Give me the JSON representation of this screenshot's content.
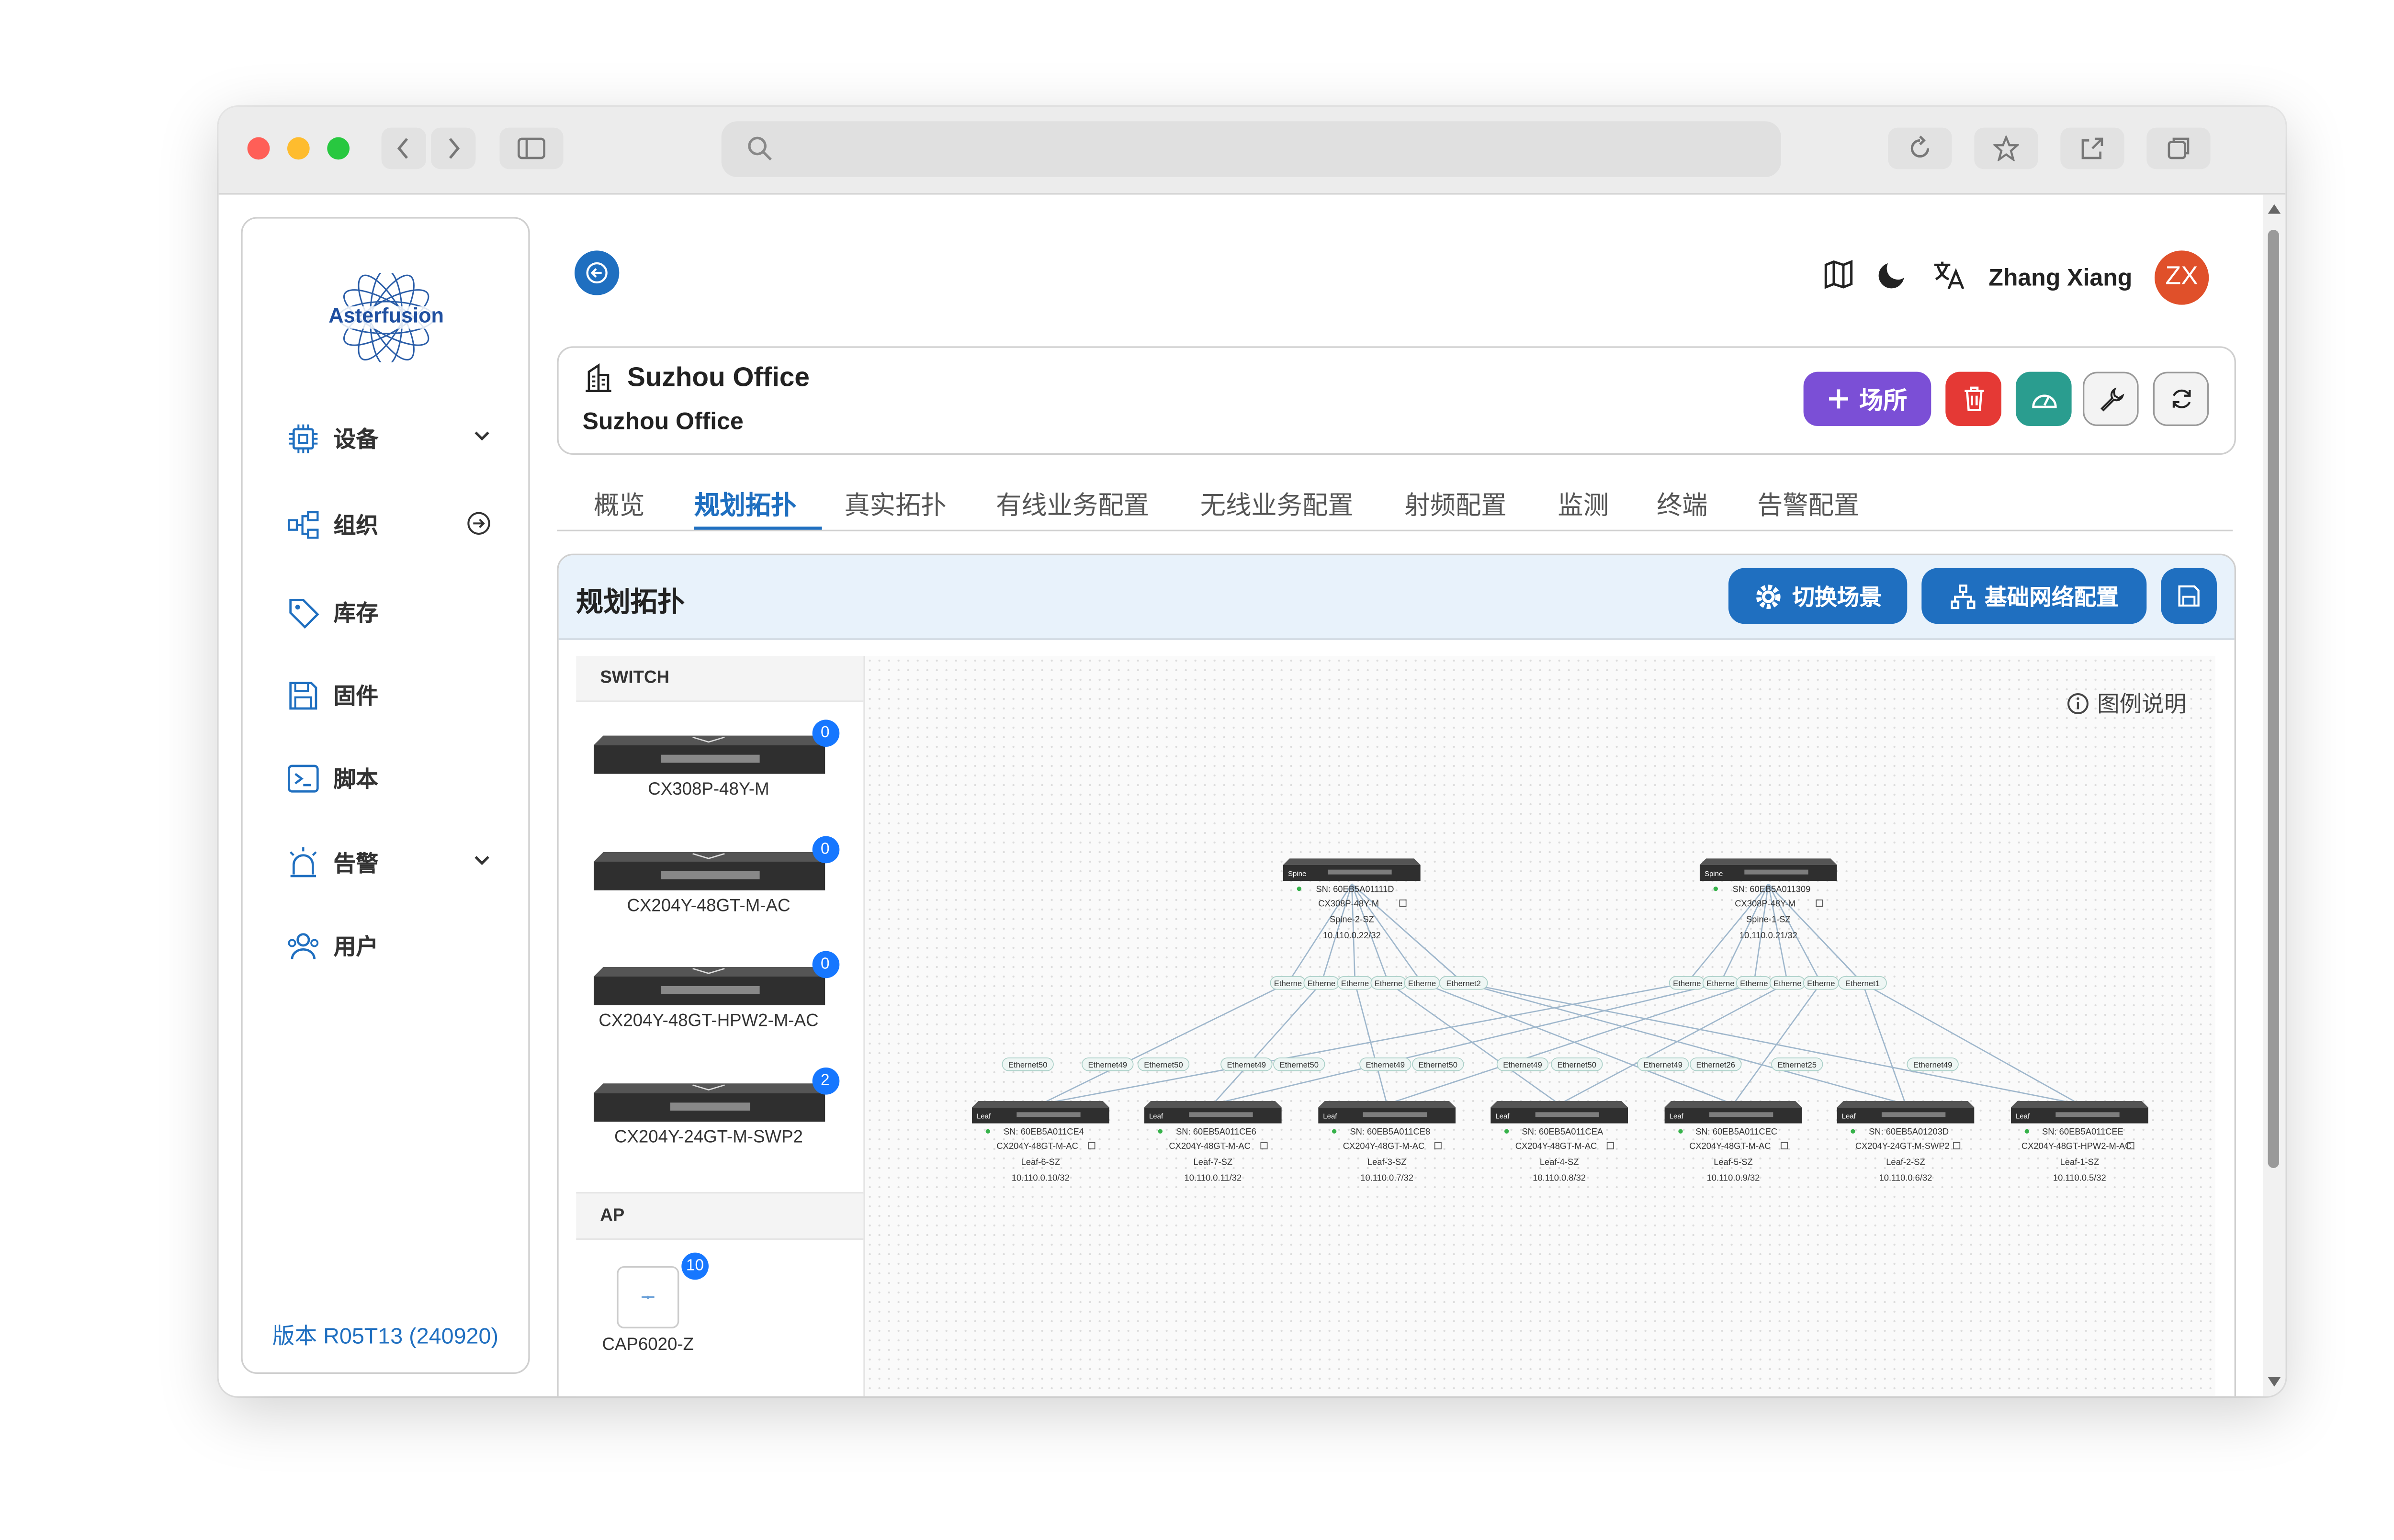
{
  "browser": {
    "back_icon": "chevron-left-icon",
    "forward_icon": "chevron-right-icon",
    "sidebar_toggle_icon": "sidebar-icon",
    "search_icon": "search-icon",
    "reload_icon": "reload-icon",
    "bookmark_icon": "star-icon",
    "share_icon": "share-icon",
    "tabs_icon": "tabs-icon",
    "url": ""
  },
  "sidebar": {
    "logo_text": "Asterfusion",
    "items": [
      {
        "label": "设备",
        "icon": "chip-icon",
        "tail": "chevron-down-icon"
      },
      {
        "label": "组织",
        "icon": "org-icon",
        "tail": "arrow-circle-icon"
      },
      {
        "label": "库存",
        "icon": "tag-icon",
        "tail": ""
      },
      {
        "label": "固件",
        "icon": "save-icon",
        "tail": ""
      },
      {
        "label": "脚本",
        "icon": "terminal-icon",
        "tail": ""
      },
      {
        "label": "告警",
        "icon": "alarm-icon",
        "tail": "chevron-down-icon"
      },
      {
        "label": "用户",
        "icon": "users-icon",
        "tail": ""
      }
    ],
    "version": "版本 R05T13 (240920)"
  },
  "topbar": {
    "user_name": "Zhang Xiang",
    "avatar_initials": "ZX",
    "avatar_color": "#e0502a"
  },
  "site": {
    "title": "Suzhou Office",
    "subtitle": "Suzhou Office",
    "add_button": "场所",
    "accent_purple": "#7b4fd6",
    "accent_red": "#e53935",
    "accent_teal": "#2a9d8f"
  },
  "tabs": [
    "概览",
    "规划拓扑",
    "真实拓扑",
    "有线业务配置",
    "无线业务配置",
    "射频配置",
    "监测",
    "终端",
    "告警配置"
  ],
  "active_tab": "规划拓扑",
  "topology": {
    "title": "规划拓扑",
    "switch_scene": "切换场景",
    "base_network": "基础网络配置",
    "legend": "图例说明",
    "palette": {
      "switch_header": "SWITCH",
      "switches": [
        {
          "model": "CX308P-48Y-M",
          "count": "0"
        },
        {
          "model": "CX204Y-48GT-M-AC",
          "count": "0"
        },
        {
          "model": "CX204Y-48GT-HPW2-M-AC",
          "count": "0"
        },
        {
          "model": "CX204Y-24GT-M-SWP2",
          "count": "2"
        }
      ],
      "ap_header": "AP",
      "aps": [
        {
          "model": "CAP6020-Z",
          "count": "10"
        }
      ]
    },
    "spines": [
      {
        "tag": "Spine",
        "sn": "SN: 60EB5A01111D",
        "model": "CX308P-48Y-M",
        "name": "Spine-2-SZ",
        "ip": "10.110.0.22/32"
      },
      {
        "tag": "Spine",
        "sn": "SN: 60EB5A011309",
        "model": "CX308P-48Y-M",
        "name": "Spine-1-SZ",
        "ip": "10.110.0.21/32"
      }
    ],
    "leaves": [
      {
        "tag": "Leaf",
        "sn": "SN: 60EB5A011CE4",
        "model": "CX204Y-48GT-M-AC",
        "name": "Leaf-6-SZ",
        "ip": "10.110.0.10/32"
      },
      {
        "tag": "Leaf",
        "sn": "SN: 60EB5A011CE6",
        "model": "CX204Y-48GT-M-AC",
        "name": "Leaf-7-SZ",
        "ip": "10.110.0.11/32"
      },
      {
        "tag": "Leaf",
        "sn": "SN: 60EB5A011CE8",
        "model": "CX204Y-48GT-M-AC",
        "name": "Leaf-3-SZ",
        "ip": "10.110.0.7/32"
      },
      {
        "tag": "Leaf",
        "sn": "SN: 60EB5A011CEA",
        "model": "CX204Y-48GT-M-AC",
        "name": "Leaf-4-SZ",
        "ip": "10.110.0.8/32"
      },
      {
        "tag": "Leaf",
        "sn": "SN: 60EB5A011CEC",
        "model": "CX204Y-48GT-M-AC",
        "name": "Leaf-5-SZ",
        "ip": "10.110.0.9/32"
      },
      {
        "tag": "Leaf",
        "sn": "SN: 60EB5A01203D",
        "model": "CX204Y-24GT-M-SWP2",
        "name": "Leaf-2-SZ",
        "ip": "10.110.0.6/32"
      },
      {
        "tag": "Leaf",
        "sn": "SN: 60EB5A011CEE",
        "model": "CX204Y-48GT-HPW2-M-AC",
        "name": "Leaf-1-SZ",
        "ip": "10.110.0.5/32"
      }
    ],
    "spine_port_labels": [
      [
        "Etherne",
        "Etherne",
        "Etherne",
        "Etherne",
        "Etherne",
        "Ethernet2"
      ],
      [
        "Etherne",
        "Etherne",
        "Etherne",
        "Etherne",
        "Etherne",
        "Ethernet1"
      ]
    ],
    "leaf_port_labels": [
      "Ethernet50",
      "Ethernet49",
      "Ethernet50",
      "Ethernet49",
      "Ethernet50",
      "Ethernet49",
      "Ethernet50",
      "Ethernet49",
      "Ethernet50",
      "Ethernet49",
      "Ethernet26",
      "Ethernet25",
      "Ethernet49"
    ]
  }
}
